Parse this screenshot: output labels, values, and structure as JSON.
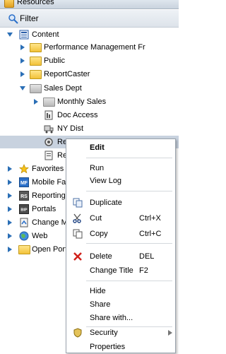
{
  "panel": {
    "title": "Resources",
    "filter_label": "Filter"
  },
  "tree": {
    "content": "Content",
    "performance_management": "Performance Management Fr",
    "public": "Public",
    "reportcaster": "ReportCaster",
    "sales_dept": "Sales Dept",
    "monthly_sales": "Monthly Sales",
    "doc_access": "Doc Access",
    "ny_dist": "NY Dist",
    "selected_item": "Regional Sales",
    "next_item": "Re",
    "favorites": "Favorites",
    "mobile_favorites": "Mobile Favo",
    "reporting_server": "Reporting S",
    "portals": "Portals",
    "change_management": "Change Ma",
    "web": "Web",
    "open_portal": "Open Porta"
  },
  "context_menu": {
    "edit": "Edit",
    "run": "Run",
    "view_log": "View Log",
    "duplicate": "Duplicate",
    "cut": "Cut",
    "cut_shortcut": "Ctrl+X",
    "copy": "Copy",
    "copy_shortcut": "Ctrl+C",
    "delete": "Delete",
    "delete_shortcut": "DEL",
    "change_title": "Change Title",
    "change_title_shortcut": "F2",
    "hide": "Hide",
    "share": "Share",
    "share_with": "Share with...",
    "security": "Security",
    "properties": "Properties"
  },
  "icons": {
    "mobile_favorites_badge": "MF",
    "reporting_server_badge": "RS",
    "portals_badge": "BIP"
  },
  "colors": {
    "selection": "#c8d2df",
    "folder": "#f2c23a",
    "accent": "#2a6fc9",
    "delete": "#d0201a"
  }
}
